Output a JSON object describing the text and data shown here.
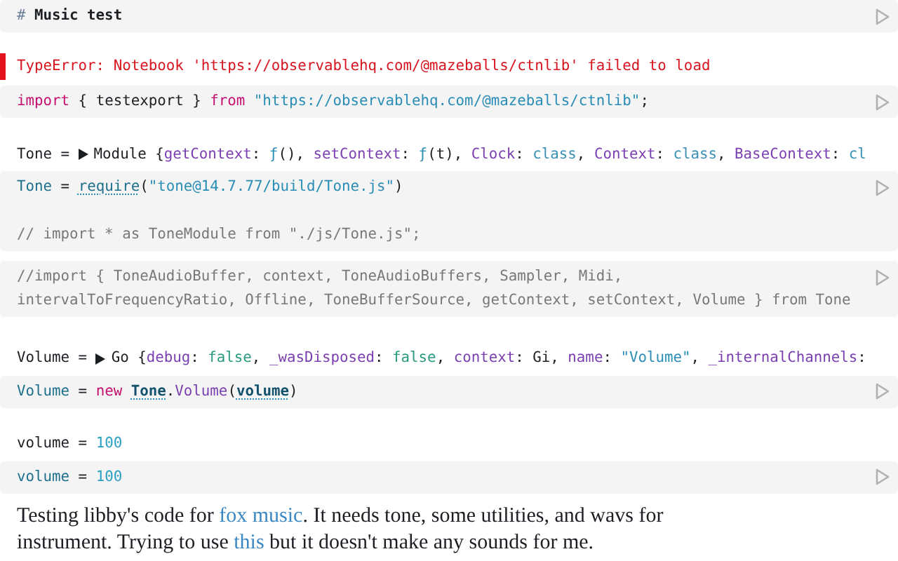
{
  "cells": [
    {
      "kind": "code",
      "lines": [
        {
          "kind": "text",
          "tokens": [
            {
              "kind": "heading-mark",
              "text": "# "
            },
            {
              "kind": "heading",
              "text": "Music test"
            }
          ]
        }
      ]
    },
    {
      "kind": "error",
      "text": "TypeError: Notebook 'https://observablehq.com/@mazeballs/ctnlib' failed to load"
    },
    {
      "kind": "code",
      "lines": [
        {
          "kind": "text",
          "tokens": [
            {
              "kind": "keyword",
              "text": "import"
            },
            {
              "kind": "plain",
              "text": " { testexport } "
            },
            {
              "kind": "keyword",
              "text": "from "
            },
            {
              "kind": "string",
              "text": "\"https://observablehq.com/@mazeballs/ctnlib\""
            },
            {
              "kind": "plain",
              "text": ";"
            }
          ]
        }
      ]
    },
    {
      "kind": "output",
      "tokens": [
        {
          "kind": "plain",
          "text": "Tone = "
        },
        {
          "kind": "disclosure"
        },
        {
          "kind": "plain",
          "text": "Module {"
        },
        {
          "kind": "property",
          "text": "getContext"
        },
        {
          "kind": "plain",
          "text": ": "
        },
        {
          "kind": "fn",
          "text": "ƒ"
        },
        {
          "kind": "plain",
          "text": "(), "
        },
        {
          "kind": "property",
          "text": "setContext"
        },
        {
          "kind": "plain",
          "text": ": "
        },
        {
          "kind": "fn",
          "text": "ƒ"
        },
        {
          "kind": "plain",
          "text": "(t), "
        },
        {
          "kind": "property",
          "text": "Clock"
        },
        {
          "kind": "plain",
          "text": ": "
        },
        {
          "kind": "class",
          "text": "class"
        },
        {
          "kind": "plain",
          "text": ", "
        },
        {
          "kind": "property",
          "text": "Context"
        },
        {
          "kind": "plain",
          "text": ": "
        },
        {
          "kind": "class",
          "text": "class"
        },
        {
          "kind": "plain",
          "text": ", "
        },
        {
          "kind": "property",
          "text": "BaseContext"
        },
        {
          "kind": "plain",
          "text": ": "
        },
        {
          "kind": "class",
          "text": "cl"
        }
      ]
    },
    {
      "kind": "code",
      "lines": [
        {
          "kind": "text",
          "tokens": [
            {
              "kind": "def",
              "text": "Tone"
            },
            {
              "kind": "plain",
              "text": " = "
            },
            {
              "kind": "call",
              "text": "require"
            },
            {
              "kind": "plain",
              "text": "("
            },
            {
              "kind": "string",
              "text": "\"tone@14.7.77/build/Tone.js\""
            },
            {
              "kind": "plain",
              "text": ")"
            }
          ]
        },
        {
          "kind": "blank"
        },
        {
          "kind": "text",
          "tokens": [
            {
              "kind": "comment",
              "text": "// import * as ToneModule from \"./js/Tone.js\";"
            }
          ]
        }
      ]
    },
    {
      "kind": "code",
      "lines": [
        {
          "kind": "text",
          "tokens": [
            {
              "kind": "comment",
              "text": "//import { ToneAudioBuffer, context, ToneAudioBuffers, Sampler, Midi,"
            }
          ]
        },
        {
          "kind": "text",
          "tokens": [
            {
              "kind": "comment",
              "text": "intervalToFrequencyRatio, Offline, ToneBufferSource, getContext, setContext, Volume } from Tone"
            }
          ]
        }
      ]
    },
    {
      "kind": "output",
      "tokens": [
        {
          "kind": "plain",
          "text": "Volume = "
        },
        {
          "kind": "disclosure"
        },
        {
          "kind": "plain",
          "text": "Go {"
        },
        {
          "kind": "property",
          "text": "debug"
        },
        {
          "kind": "plain",
          "text": ": "
        },
        {
          "kind": "boolean",
          "text": "false"
        },
        {
          "kind": "plain",
          "text": ", "
        },
        {
          "kind": "property",
          "text": "_wasDisposed"
        },
        {
          "kind": "plain",
          "text": ": "
        },
        {
          "kind": "boolean",
          "text": "false"
        },
        {
          "kind": "plain",
          "text": ", "
        },
        {
          "kind": "property",
          "text": "context"
        },
        {
          "kind": "plain",
          "text": ": Gi, "
        },
        {
          "kind": "property",
          "text": "name"
        },
        {
          "kind": "plain",
          "text": ": "
        },
        {
          "kind": "string",
          "text": "\"Volume\""
        },
        {
          "kind": "plain",
          "text": ", "
        },
        {
          "kind": "property",
          "text": "_internalChannels"
        },
        {
          "kind": "plain",
          "text": ":"
        }
      ]
    },
    {
      "kind": "code",
      "lines": [
        {
          "kind": "text",
          "tokens": [
            {
              "kind": "def",
              "text": "Volume"
            },
            {
              "kind": "plain",
              "text": " = "
            },
            {
              "kind": "keyword",
              "text": "new "
            },
            {
              "kind": "ref",
              "text": "Tone"
            },
            {
              "kind": "plain",
              "text": "."
            },
            {
              "kind": "property",
              "text": "Volume"
            },
            {
              "kind": "plain",
              "text": "("
            },
            {
              "kind": "ref",
              "text": "volume"
            },
            {
              "kind": "plain",
              "text": ")"
            }
          ]
        }
      ]
    },
    {
      "kind": "output",
      "tokens": [
        {
          "kind": "plain",
          "text": "volume = "
        },
        {
          "kind": "number",
          "text": "100"
        }
      ]
    },
    {
      "kind": "code",
      "lines": [
        {
          "kind": "text",
          "tokens": [
            {
              "kind": "def",
              "text": "volume"
            },
            {
              "kind": "plain",
              "text": " = "
            },
            {
              "kind": "number",
              "text": "100"
            }
          ]
        }
      ]
    },
    {
      "kind": "prose",
      "segments": [
        {
          "text": "Testing libby's code for "
        },
        {
          "text": "fox music",
          "link": true
        },
        {
          "text": ". It needs tone, some utilities, and wavs for instrument. Trying to use "
        },
        {
          "text": "this",
          "link": true
        },
        {
          "text": " but it doesn't make any sounds for me."
        }
      ]
    }
  ]
}
